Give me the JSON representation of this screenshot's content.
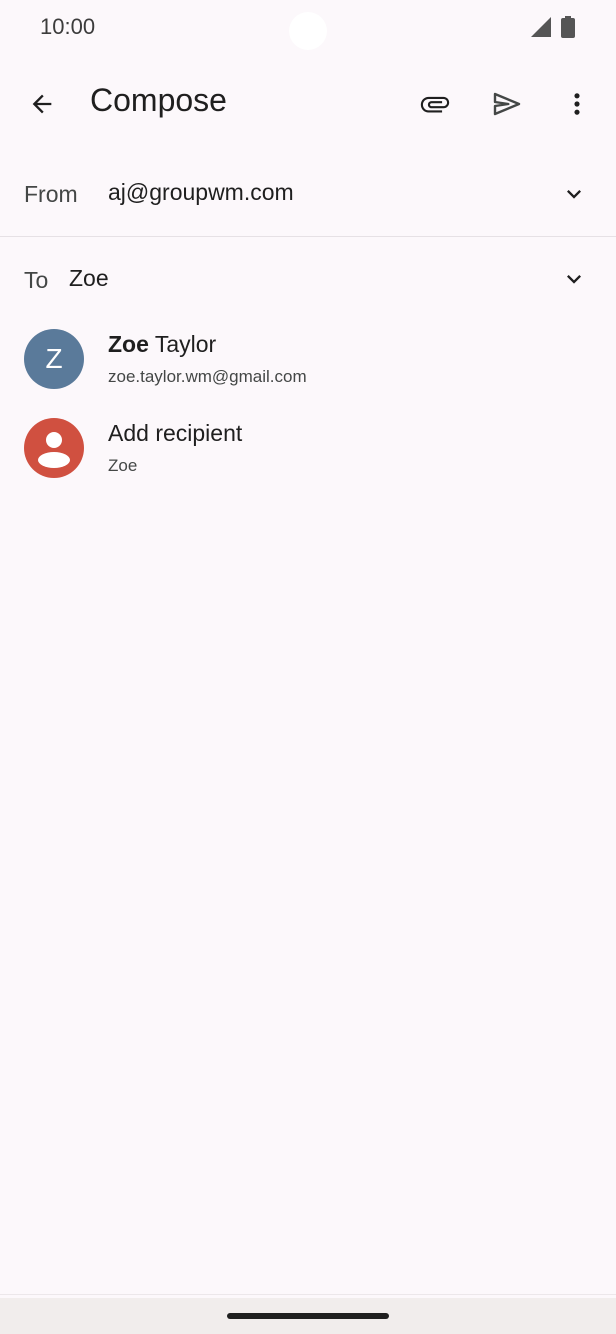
{
  "status_bar": {
    "time": "10:00"
  },
  "app_bar": {
    "title": "Compose",
    "icons": [
      "back-arrow-icon",
      "paperclip-icon",
      "send-icon",
      "more-vert-icon"
    ]
  },
  "from_field": {
    "label": "From",
    "value": "aj@groupwm.com"
  },
  "to_field": {
    "label": "To",
    "value": "Zoe"
  },
  "suggestions": [
    {
      "name_bold": "Zoe",
      "name_rest": " Taylor",
      "email": "zoe.taylor.wm@gmail.com",
      "avatar_letter": "Z",
      "avatar_color": "#5a7a9a"
    },
    {
      "name": "Add recipient",
      "sub": "Zoe",
      "avatar_icon": "person-icon",
      "avatar_color": "#d05040"
    }
  ],
  "colors": {
    "background": "#fcf8fb",
    "text_primary": "#1f1f1f",
    "text_secondary": "#444746"
  }
}
